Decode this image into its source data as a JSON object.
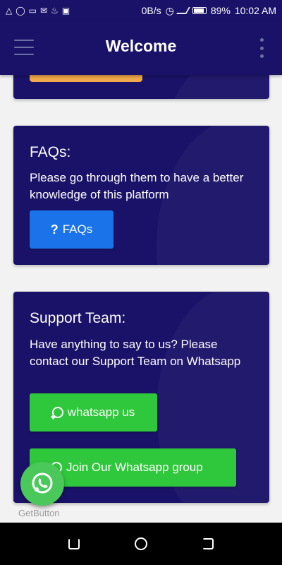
{
  "status_bar": {
    "net_speed": "0B/s",
    "battery": "89%",
    "time": "10:02 AM"
  },
  "app_bar": {
    "title": "Welcome"
  },
  "faq_card": {
    "heading": "FAQs:",
    "description": "Please go through them to have a better knowledge of this platform",
    "button_label": "FAQs"
  },
  "support_card": {
    "heading": "Support Team:",
    "description": "Have anything to say to us? Please contact our Support Team on Whatsapp",
    "whatsapp_button_label": "whatsapp us",
    "group_button_label": "Join Our Whatsapp group"
  },
  "floating_widget": {
    "caption": "GetButton"
  },
  "colors": {
    "primary": "#1a1268",
    "faq_button": "#1a73e8",
    "whatsapp_green": "#2fc73b",
    "accent_orange": "#f0a84a"
  },
  "icons": [
    "menu-icon",
    "more-vert-icon",
    "question-icon",
    "whatsapp-icon",
    "back-icon",
    "home-icon",
    "recents-icon"
  ]
}
